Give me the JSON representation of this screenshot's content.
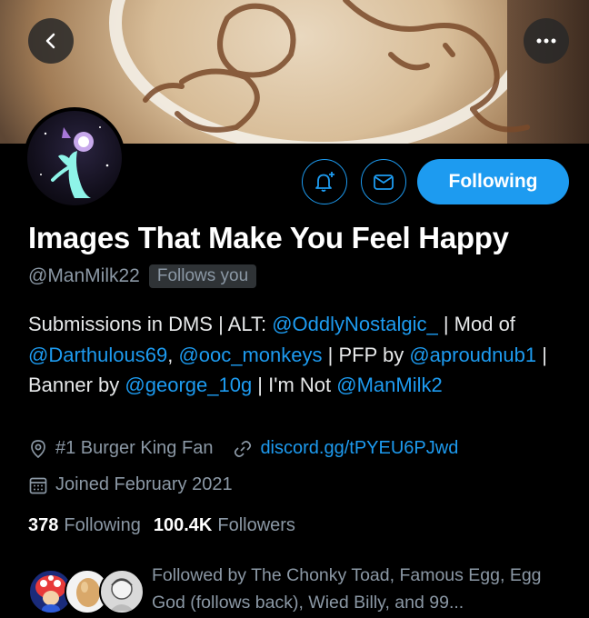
{
  "profile": {
    "name": "Images That Make You Feel Happy",
    "handle": "@ManMilk22",
    "follows_you": "Follows you",
    "bio": {
      "t1": "Submissions in DMS | ALT: ",
      "m1": "@OddlyNostalgic_",
      "t2": " | Mod of ",
      "m2": "@Darthulous69",
      "t3": ", ",
      "m3": "@ooc_monkeys",
      "t4": " | PFP by ",
      "m4": "@aproudnub1",
      "t5": " | Banner by ",
      "m5": "@george_10g",
      "t6": " | I'm Not ",
      "m6": "@ManMilk2"
    },
    "location": "#1 Burger King Fan",
    "website": "discord.gg/tPYEU6PJwd",
    "joined": "Joined February 2021",
    "following_count": "378",
    "following_label": "Following",
    "followers_count": "100.4K",
    "followers_label": "Followers",
    "followed_by": "Followed by The Chonky Toad, Famous Egg, Egg God (follows back), Wied Billy, and 99..."
  },
  "actions": {
    "follow_label": "Following"
  },
  "icons": {
    "back": "chevron-left-icon",
    "more": "more-horizontal-icon",
    "notify": "bell-plus-icon",
    "message": "envelope-icon",
    "location": "location-pin-icon",
    "link": "link-icon",
    "calendar": "calendar-icon"
  },
  "colors": {
    "accent": "#1d9bf0",
    "secondary_text": "#8b98a5",
    "background": "#000000"
  }
}
